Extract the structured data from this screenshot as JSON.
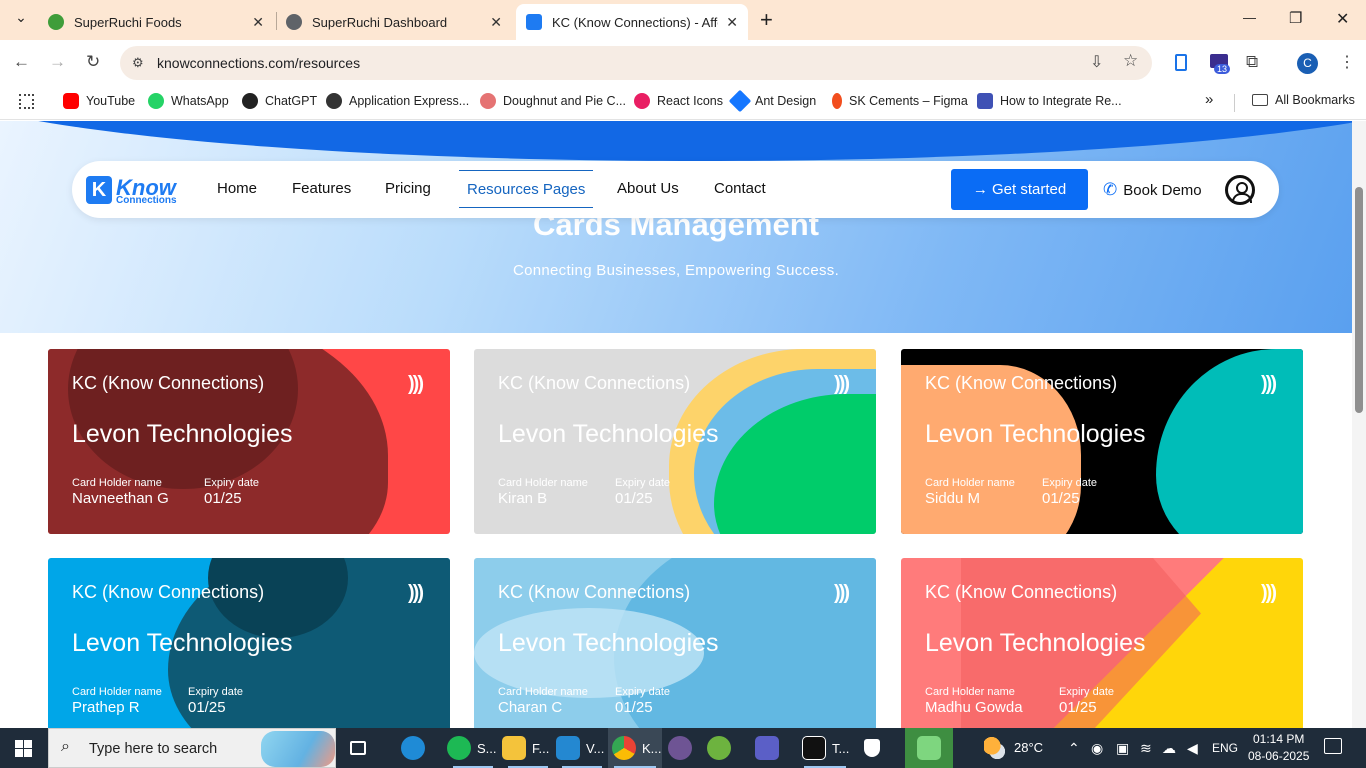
{
  "browser": {
    "tabs": [
      {
        "title": "SuperRuchi Foods",
        "close": "✕",
        "favicon_color": "#3f9d3a"
      },
      {
        "title": "SuperRuchi Dashboard",
        "close": "✕",
        "favicon_color": "#5f6368"
      },
      {
        "title": "KC (Know Connections) - Afford",
        "close": "✕",
        "favicon_color": "#1e7bf2"
      }
    ],
    "new_tab": "+",
    "tab_menu": "⌄",
    "window_controls": {
      "minimize": "—",
      "restore": "❐",
      "close": "✕"
    },
    "url": "knowconnections.com/resources",
    "profile_initial": "C",
    "extension_badge": "13",
    "bookmarks": [
      {
        "label": "YouTube",
        "color": "#ff0000"
      },
      {
        "label": "WhatsApp",
        "color": "#25d366"
      },
      {
        "label": "ChatGPT",
        "color": "#222222"
      },
      {
        "label": "Application Express...",
        "color": "#333333"
      },
      {
        "label": "Doughnut and Pie C...",
        "color": "#e57373"
      },
      {
        "label": "React Icons",
        "color": "#e91e63"
      },
      {
        "label": "Ant Design",
        "color": "#1677ff"
      },
      {
        "label": "SK Cements – Figma",
        "color": "#f24e1e"
      },
      {
        "label": "How to Integrate Re...",
        "color": "#3f51b5"
      }
    ],
    "bookmarks_more": "»",
    "all_bookmarks": "All Bookmarks"
  },
  "site": {
    "logo_line1": "Know",
    "logo_line2": "Connections",
    "nav": [
      {
        "label": "Home"
      },
      {
        "label": "Features"
      },
      {
        "label": "Pricing"
      },
      {
        "label": "Resources Pages"
      },
      {
        "label": "About Us"
      },
      {
        "label": "Contact"
      }
    ],
    "get_started": "→ Get started",
    "book_demo": "Book Demo",
    "hero_title": "Cards Management",
    "hero_subtitle": "Connecting Businesses, Empowering Success."
  },
  "cards": [
    {
      "brand": "KC (Know Connections)",
      "company": "Levon Technologies",
      "holder_label": "Card Holder name",
      "holder": "Navneethan G",
      "expiry_label": "Expiry date",
      "expiry": "01/25",
      "base": "#ff4747"
    },
    {
      "brand": "KC (Know Connections)",
      "company": "Levon Technologies",
      "holder_label": "Card Holder name",
      "holder": "Kiran B",
      "expiry_label": "Expiry date",
      "expiry": "01/25",
      "base": "#dcdcdc"
    },
    {
      "brand": "KC (Know Connections)",
      "company": "Levon Technologies",
      "holder_label": "Card Holder name",
      "holder": "Siddu M",
      "expiry_label": "Expiry date",
      "expiry": "01/25",
      "base": "#000000"
    },
    {
      "brand": "KC (Know Connections)",
      "company": "Levon Technologies",
      "holder_label": "Card Holder name",
      "holder": "Prathep R",
      "expiry_label": "Expiry date",
      "expiry": "01/25",
      "base": "#00a6e8"
    },
    {
      "brand": "KC (Know Connections)",
      "company": "Levon Technologies",
      "holder_label": "Card Holder name",
      "holder": "Charan C",
      "expiry_label": "Expiry date",
      "expiry": "01/25",
      "base": "#8dcdeb"
    },
    {
      "brand": "KC (Know Connections)",
      "company": "Levon Technologies",
      "holder_label": "Card Holder name",
      "holder": "Madhu Gowda",
      "expiry_label": "Expiry date",
      "expiry": "01/25",
      "base": "#ff7b7b"
    }
  ],
  "nfc_symbol": ")))",
  "taskbar": {
    "search_placeholder": "Type here to search",
    "apps": [
      {
        "label": "",
        "name": "task-view",
        "color": "#1f2c3a"
      },
      {
        "label": "",
        "name": "edge",
        "color": "#1f8bd6"
      },
      {
        "label": "S...",
        "name": "spotify",
        "color": "#1db954"
      },
      {
        "label": "F...",
        "name": "file-explorer",
        "color": "#f4c33b"
      },
      {
        "label": "V...",
        "name": "vscode",
        "color": "#2488d1"
      },
      {
        "label": "K...",
        "name": "chrome",
        "color": "#ea4335"
      },
      {
        "label": "",
        "name": "github",
        "color": "#6e5494"
      },
      {
        "label": "",
        "name": "spring",
        "color": "#6db33f"
      },
      {
        "label": "",
        "name": "teams",
        "color": "#5b5fc7"
      },
      {
        "label": "T...",
        "name": "tl-app",
        "color": "#111111"
      },
      {
        "label": "",
        "name": "security",
        "color": "#333333"
      },
      {
        "label": "",
        "name": "sync",
        "color": "#4caf50"
      }
    ],
    "weather": "28°C",
    "lang": "ENG",
    "time": "01:14 PM",
    "date": "08-06-2025"
  }
}
